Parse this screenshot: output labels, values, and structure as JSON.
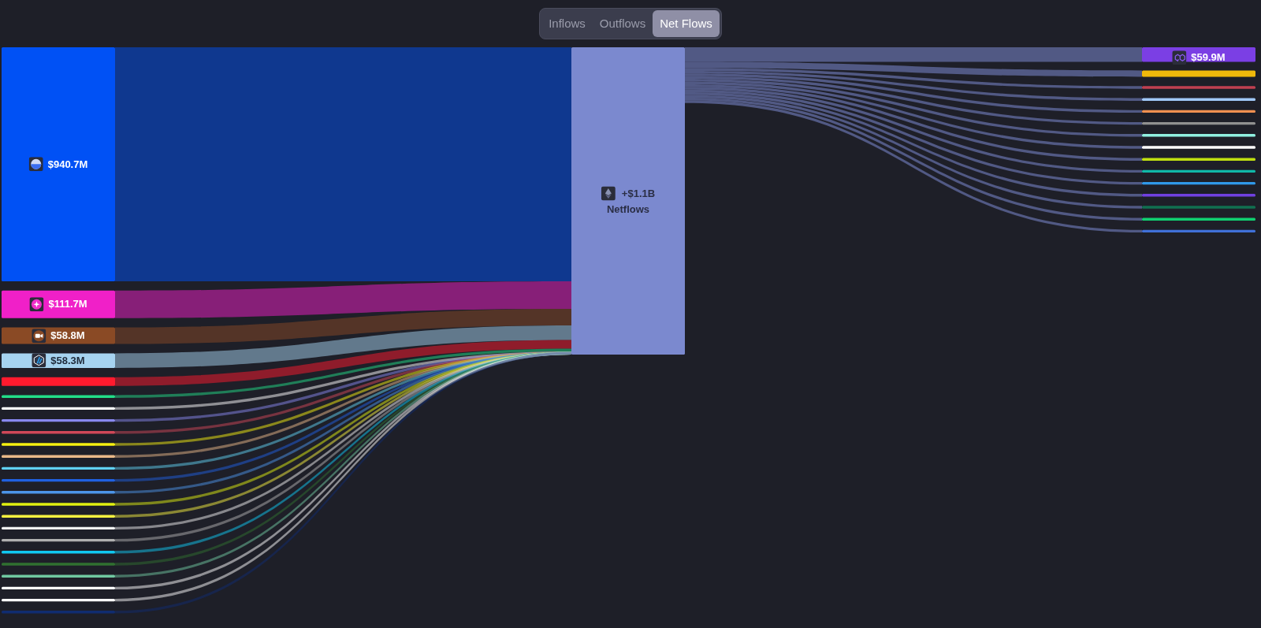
{
  "tabs": [
    {
      "label": "Inflows",
      "selected": false
    },
    {
      "label": "Outflows",
      "selected": false
    },
    {
      "label": "Net Flows",
      "selected": true
    }
  ],
  "left_nodes": [
    {
      "value": "$940.7M",
      "color": "#0051f5",
      "kind": "huge"
    },
    {
      "value": "$111.7M",
      "color": "#f020c8",
      "kind": "large"
    },
    {
      "value": "$58.8M",
      "color": "#8a4a25",
      "kind": "medium"
    },
    {
      "value": "$58.3M",
      "color": "#a6d3f0",
      "kind": "small"
    },
    {
      "color": "#ff1a2e",
      "kind": "narrow"
    },
    {
      "color": "#22dd88",
      "kind": "thin"
    },
    {
      "color": "#ffffff",
      "kind": "thin"
    },
    {
      "color": "#8888ee",
      "kind": "thin"
    },
    {
      "color": "#d04858",
      "kind": "thin"
    },
    {
      "color": "#f5f010",
      "kind": "thin"
    },
    {
      "color": "#e8b888",
      "kind": "thin"
    },
    {
      "color": "#60d0f0",
      "kind": "thin"
    },
    {
      "color": "#2060e0",
      "kind": "thin"
    },
    {
      "color": "#4c94e8",
      "kind": "thin"
    },
    {
      "color": "#e0f010",
      "kind": "thin"
    },
    {
      "color": "#f5f040",
      "kind": "thin"
    },
    {
      "color": "#f0f0f0",
      "kind": "thin"
    },
    {
      "color": "#b0b0b0",
      "kind": "thin"
    },
    {
      "color": "#10c8f0",
      "kind": "thin"
    },
    {
      "color": "#307030",
      "kind": "thin"
    },
    {
      "color": "#70c8a0",
      "kind": "thin"
    },
    {
      "color": "#ffffff",
      "kind": "thin"
    },
    {
      "color": "#fefefe",
      "kind": "thin"
    },
    {
      "color": "#102c70",
      "kind": "thin"
    }
  ],
  "center": {
    "value": "+$1.1B",
    "label": "Netflows",
    "color": "#7b89cf"
  },
  "right_nodes": [
    {
      "value": "$59.9M",
      "color": "#7b3fe4",
      "kind": "small"
    },
    {
      "color": "#f0b90b",
      "kind": "slim"
    },
    {
      "color": "#c04050",
      "kind": "thin"
    },
    {
      "color": "#a0c8f8",
      "kind": "thin"
    },
    {
      "color": "#f09050",
      "kind": "thin"
    },
    {
      "color": "#909090",
      "kind": "thin"
    },
    {
      "color": "#90f0e0",
      "kind": "thin"
    },
    {
      "color": "#ffffff",
      "kind": "thin"
    },
    {
      "color": "#c0e010",
      "kind": "thin"
    },
    {
      "color": "#10b8a8",
      "kind": "thin"
    },
    {
      "color": "#3098e8",
      "kind": "thin"
    },
    {
      "color": "#7040e0",
      "kind": "thin"
    },
    {
      "color": "#107050",
      "kind": "thin"
    },
    {
      "color": "#10d070",
      "kind": "thin"
    },
    {
      "color": "#4070d8",
      "kind": "thin"
    }
  ]
}
